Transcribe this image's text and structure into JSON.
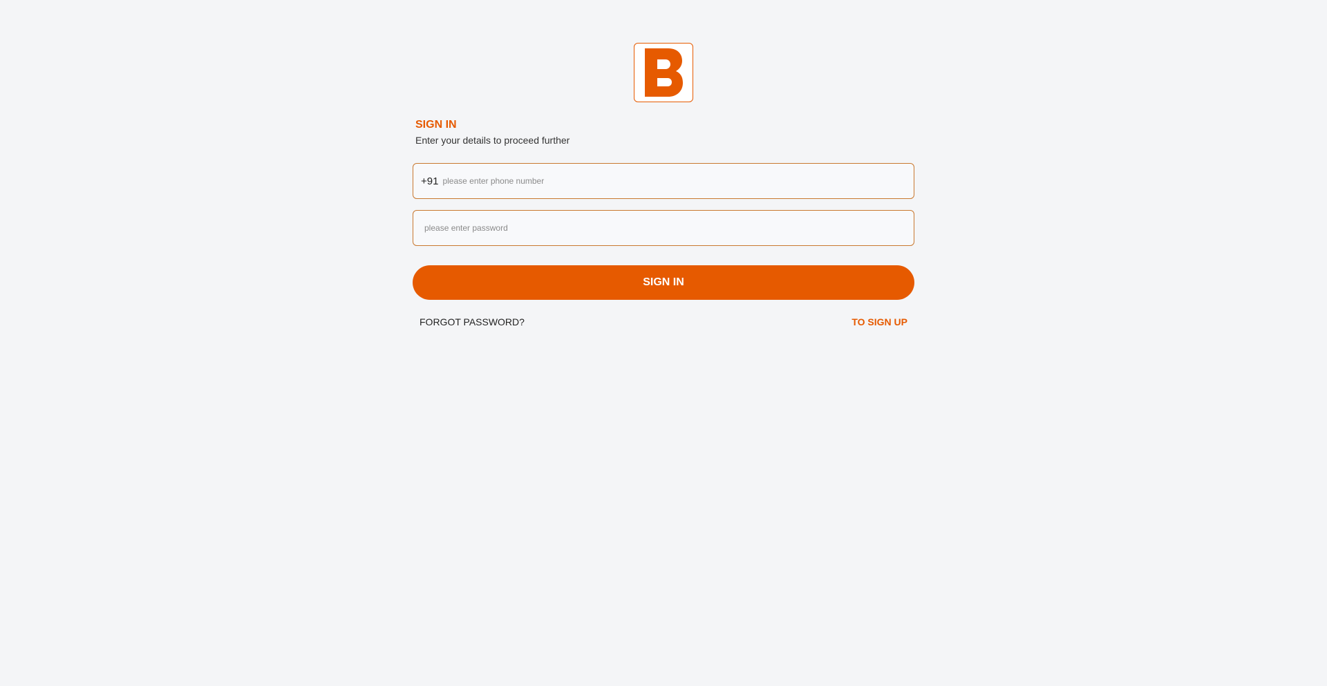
{
  "brand": {
    "logo_icon": "brand-b-logo-icon",
    "accent_color": "#e65a00"
  },
  "header": {
    "title": "SIGN IN",
    "subtitle": "Enter your details to proceed further"
  },
  "form": {
    "phone": {
      "country_code": "+91",
      "placeholder": "please enter phone number",
      "value": ""
    },
    "password": {
      "placeholder": "please enter password",
      "value": ""
    },
    "submit_label": "SIGN IN"
  },
  "links": {
    "forgot_password": "FORGOT PASSWORD?",
    "sign_up": "TO SIGN UP"
  }
}
